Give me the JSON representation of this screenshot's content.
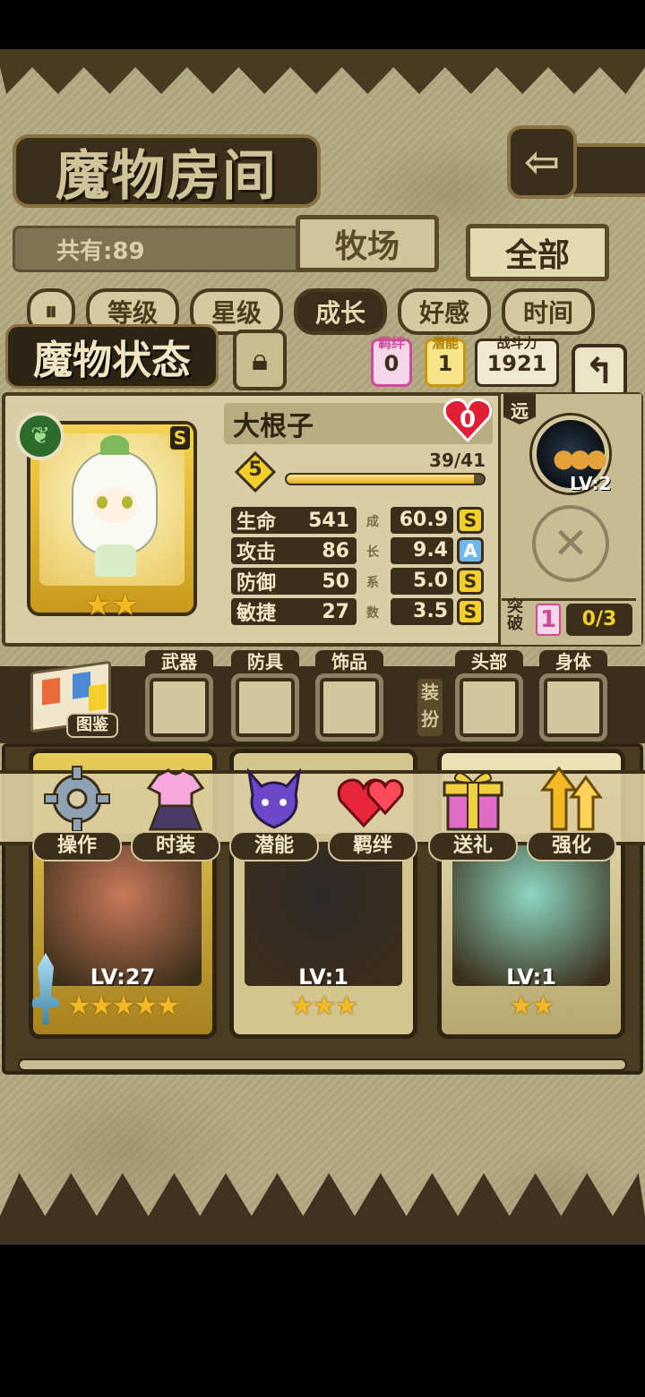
{
  "header": {
    "title": "魔物房间",
    "back_icon": "back-arrow-icon"
  },
  "collection": {
    "count_label": "共有:89",
    "tabs": [
      {
        "label": "牧场",
        "active": false
      },
      {
        "label": "全部",
        "active": true
      }
    ]
  },
  "sort": {
    "toggle_icon": "pause-icon",
    "options": [
      {
        "label": "等级",
        "active": false
      },
      {
        "label": "星级",
        "active": false
      },
      {
        "label": "成长",
        "active": true
      },
      {
        "label": "好感",
        "active": false
      },
      {
        "label": "时间",
        "active": false
      }
    ]
  },
  "status": {
    "title": "魔物状态",
    "lock_icon": "lock-icon",
    "bond": {
      "label": "羁绊",
      "value": "0"
    },
    "potential": {
      "label": "潜能",
      "value": "1"
    },
    "power": {
      "label": "战斗力",
      "value": "1921"
    },
    "return_icon": "return-arrow-icon"
  },
  "monster": {
    "name": "大根子",
    "affection": "0",
    "element_icon": "leaf-icon",
    "rank": "S",
    "stars": 2,
    "level": "5",
    "exp_text": "39/41",
    "exp_ratio": 0.951,
    "stats": [
      {
        "label": "生命",
        "value": "541",
        "growth": "60.9",
        "grade": "S"
      },
      {
        "label": "攻击",
        "value": "86",
        "growth": "9.4",
        "grade": "A"
      },
      {
        "label": "防御",
        "value": "50",
        "growth": "5.0",
        "grade": "S"
      },
      {
        "label": "敏捷",
        "value": "27",
        "growth": "3.5",
        "grade": "S"
      }
    ],
    "growth_label": [
      "成",
      "长",
      "系",
      "数"
    ],
    "range_tag": "远",
    "skill": {
      "icon": "crowd-skill-icon",
      "level": "LV:2"
    },
    "empty_slot_icon": "close-icon",
    "breakthrough": {
      "label": "突破",
      "value": "1",
      "progress": "0/3"
    }
  },
  "equipment": {
    "book_label": "图鉴",
    "slots": [
      {
        "label": "武器"
      },
      {
        "label": "防具"
      },
      {
        "label": "饰品"
      },
      {
        "label": "头部"
      },
      {
        "label": "身体"
      }
    ],
    "dress_tag": "装扮"
  },
  "actions": [
    {
      "label": "操作",
      "icon": "gear-icon",
      "color": "#8fa2b5"
    },
    {
      "label": "时装",
      "icon": "costume-icon",
      "color": "#f48fd0"
    },
    {
      "label": "潜能",
      "icon": "devil-icon",
      "color": "#7d5bd6"
    },
    {
      "label": "羁绊",
      "icon": "hearts-icon",
      "color": "#e8263a"
    },
    {
      "label": "送礼",
      "icon": "gift-icon",
      "color": "#f0d040"
    },
    {
      "label": "强化",
      "icon": "upgrade-arrows-icon",
      "color": "#f3b924"
    }
  ],
  "roster": [
    {
      "level": "LV:27",
      "stars": "★★★★★",
      "color": "#c9795a"
    },
    {
      "level": "LV:1",
      "stars": "★★★",
      "color": "#2e2a2a"
    },
    {
      "level": "LV:1",
      "stars": "★★",
      "color": "#8cd6c2"
    }
  ],
  "colors": {
    "wood_dark": "#3b2e1a",
    "parchment": "#d8cda5",
    "gold": "#f3cf2a",
    "pink": "#d04a9a"
  }
}
